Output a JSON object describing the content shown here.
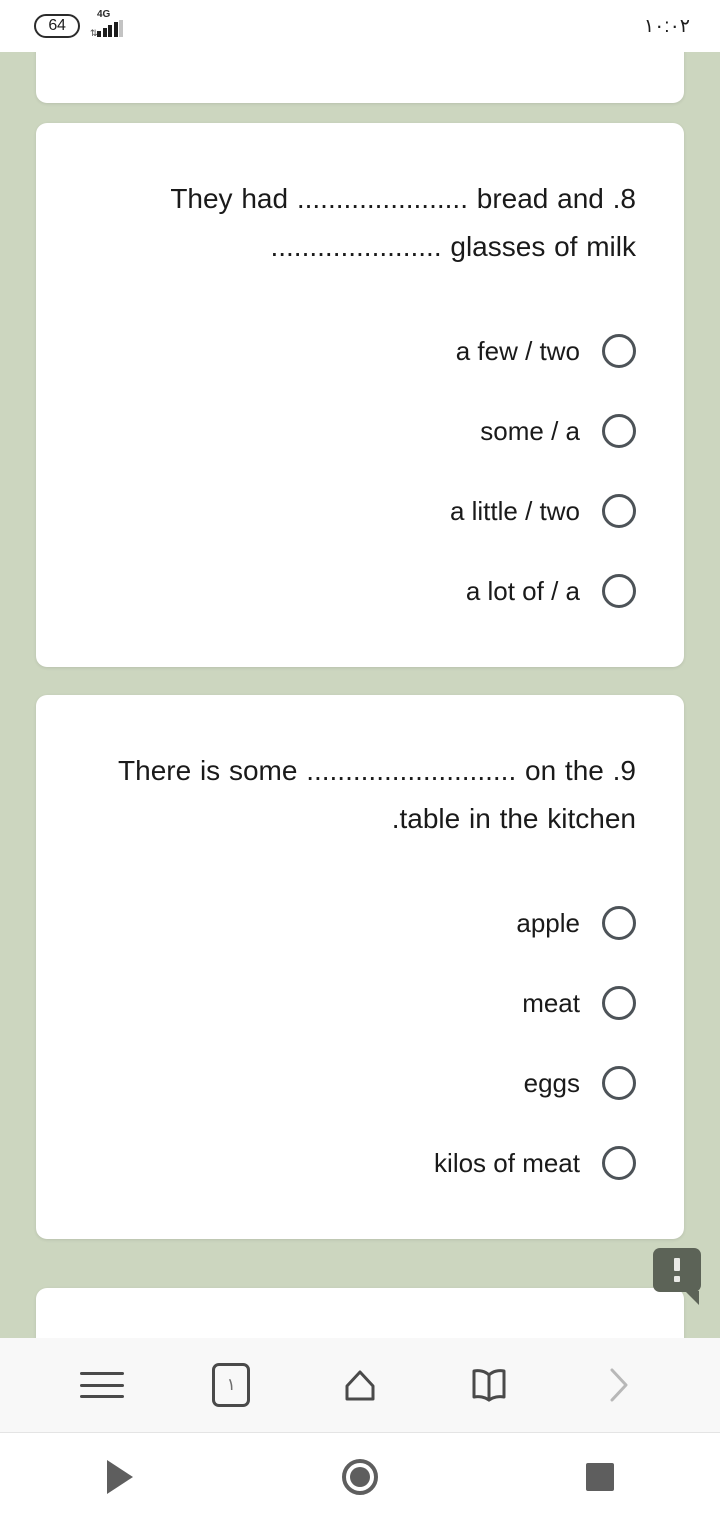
{
  "status_bar": {
    "battery_level": "64",
    "network_type": "4G",
    "data_arrows_icon": "data-transfer-arrows-icon",
    "signal_icon": "signal-bars-icon",
    "time": "١٠:٠٢"
  },
  "theme": {
    "page_background": "#ccd6bf",
    "card_background": "#ffffff",
    "text_color": "#1a1a1a",
    "radio_border": "#4d5358",
    "tooltip_background": "#5c6357",
    "toolbar_background": "#f8f8f8",
    "icon_color": "#4a4a4a",
    "disabled_icon_color": "#b8b8b8"
  },
  "quiz": {
    "questions": [
      {
        "number": "8",
        "prompt_line_1": "They had ...................... bread and .8",
        "prompt_line_2": "...................... glasses of milk",
        "options": [
          {
            "label": "a few / two",
            "selected": false
          },
          {
            "label": "some / a",
            "selected": false
          },
          {
            "label": "a little / two",
            "selected": false
          },
          {
            "label": "a lot of / a",
            "selected": false
          }
        ]
      },
      {
        "number": "9",
        "prompt_line_1": "There is some ........................... on the .9",
        "prompt_line_2": ".table in the kitchen",
        "options": [
          {
            "label": "apple",
            "selected": false
          },
          {
            "label": "meat",
            "selected": false
          },
          {
            "label": "eggs",
            "selected": false
          },
          {
            "label": "kilos of meat",
            "selected": false
          }
        ]
      }
    ]
  },
  "tooltip": {
    "icon": "exclamation-mark-icon",
    "text": "!"
  },
  "browser_toolbar": {
    "menu_icon": "hamburger-menu-icon",
    "tab_count": "١",
    "tabs_icon": "tab-counter-icon",
    "home_icon": "home-icon",
    "bookmarks_icon": "open-book-icon",
    "forward_icon": "chevron-forward-icon",
    "forward_enabled": false
  },
  "android_nav": {
    "back_icon": "back-triangle-icon",
    "home_icon": "home-circle-icon",
    "recents_icon": "recents-square-icon"
  }
}
